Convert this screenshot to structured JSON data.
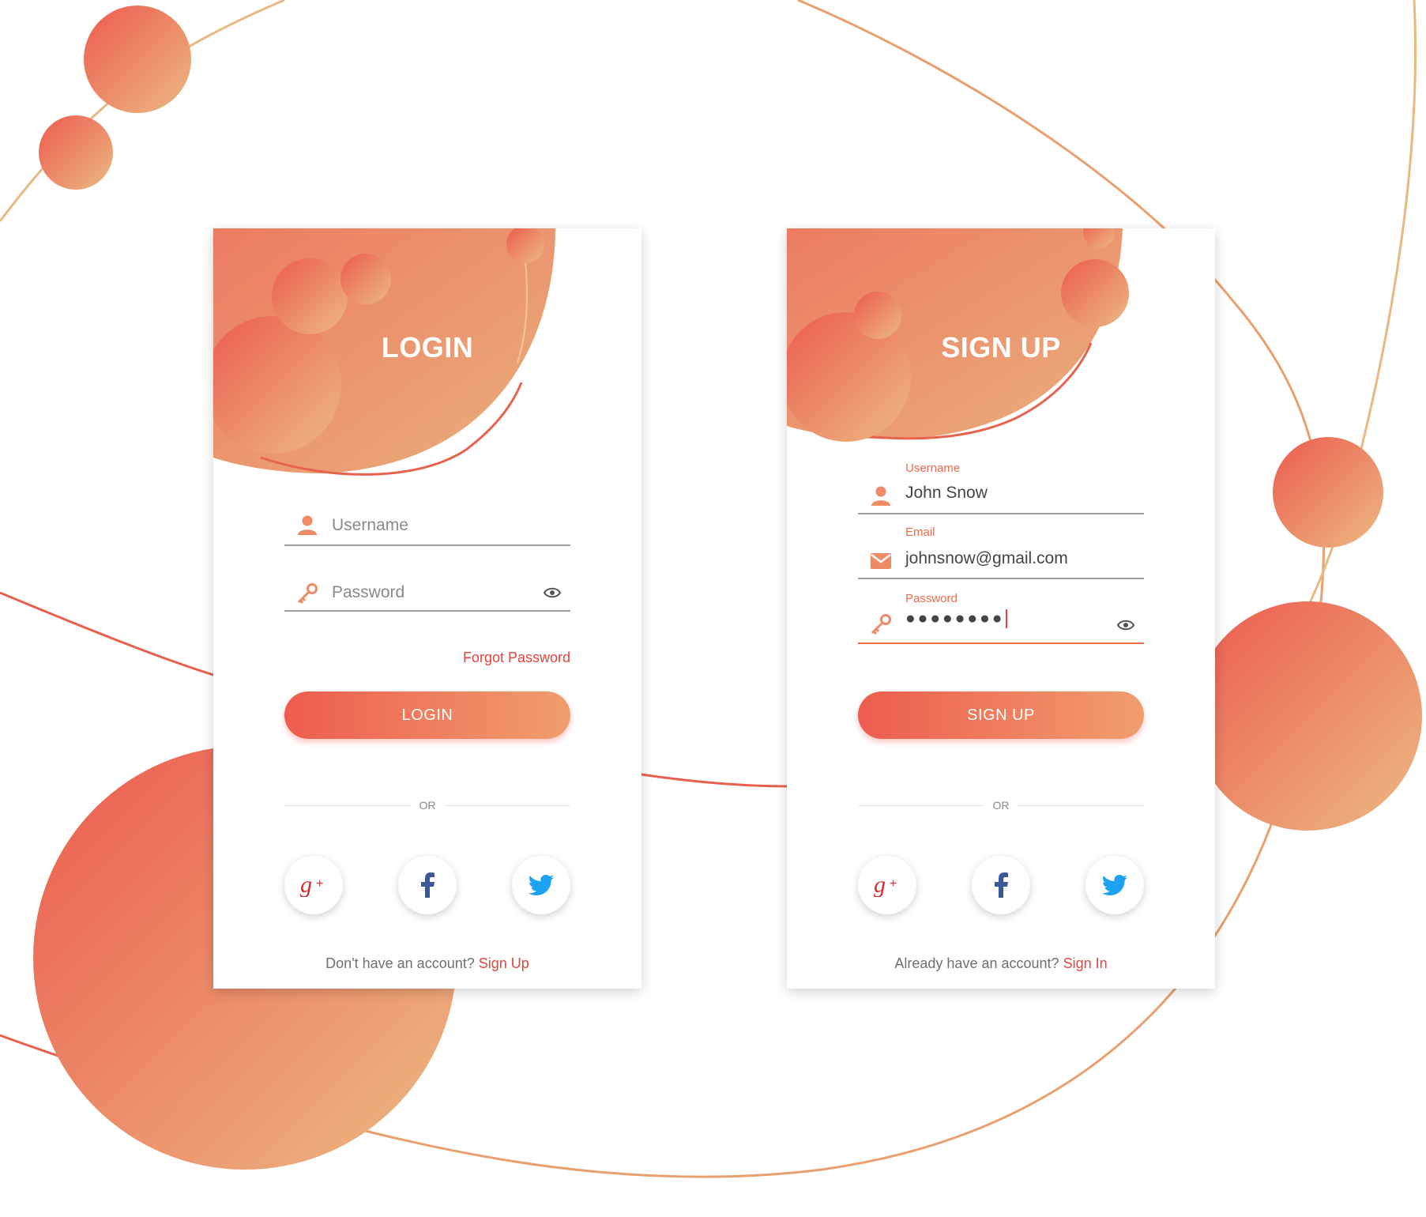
{
  "colors": {
    "accent_start": "#ee5c4f",
    "accent_end": "#f0b47e",
    "link": "#e8423c",
    "label": "#ee6b4d"
  },
  "login": {
    "title": "LOGIN",
    "username_placeholder": "Username",
    "password_placeholder": "Password",
    "forgot_password": "Forgot Password",
    "button": "LOGIN",
    "or": "OR",
    "social": [
      "google-plus-icon",
      "facebook-icon",
      "twitter-icon"
    ],
    "footer_text": "Don't have an account?",
    "footer_link": "Sign Up"
  },
  "signup": {
    "title": "SIGN UP",
    "username_label": "Username",
    "username_value": "John Snow",
    "email_label": "Email",
    "email_value": "johnsnow@gmail.com",
    "password_label": "Password",
    "password_value": "●●●●●●●●",
    "button": "SIGN UP",
    "or": "OR",
    "social": [
      "google-plus-icon",
      "facebook-icon",
      "twitter-icon"
    ],
    "footer_text": "Already have an account?",
    "footer_link": "Sign In"
  }
}
